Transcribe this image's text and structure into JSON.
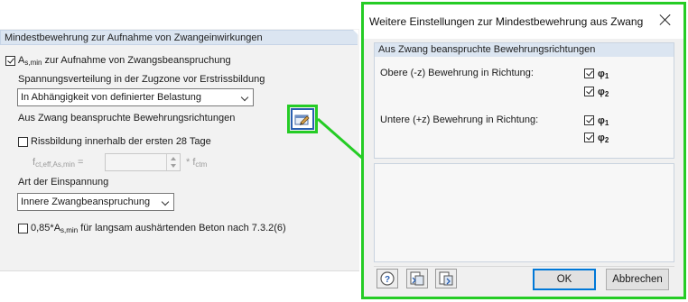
{
  "left_panel": {
    "section_title": "Mindestbewehrung zur Aufnahme von Zwangeinwirkungen",
    "as_min_checkbox": {
      "checked": true,
      "label_prefix": "A",
      "label_sub": "s,min",
      "label_rest": " zur Aufnahme von Zwangsbeanspruchung"
    },
    "stress_label": "Spannungsverteilung in der Zugzone vor Erstrissbildung",
    "stress_dropdown_value": "In Abhängigkeit von definierter Belastung",
    "directions_label": "Aus Zwang beanspruchte Bewehrungsrichtungen",
    "settings_button_icon": "settings-edit-icon",
    "crack_checkbox": {
      "checked": false,
      "label": "Rissbildung innerhalb der ersten 28 Tage"
    },
    "fct_label": {
      "main": "f",
      "sub": "ct,eff,As,min",
      "suffix": " ="
    },
    "fct_value": "",
    "fct_unit": {
      "prefix": "* f",
      "sub": "ctm"
    },
    "restraint_label": "Art der Einspannung",
    "restraint_dropdown_value": "Innere Zwangbeanspruchung",
    "slow_checkbox": {
      "checked": false,
      "label_prefix": "0,85*A",
      "label_sub": "s,min",
      "label_rest": " für langsam aushärtenden Beton nach 7.3.2(6)"
    }
  },
  "dialog": {
    "title": "Weitere Einstellungen zur Mindestbewehrung aus Zwang",
    "group_title": "Aus Zwang beanspruchte Bewehrungsrichtungen",
    "top_label": "Obere (-z) Bewehrung in Richtung:",
    "top_options": [
      {
        "label": "φ",
        "sub": "1",
        "checked": true
      },
      {
        "label": "φ",
        "sub": "2",
        "checked": true
      }
    ],
    "bottom_label": "Untere (+z) Bewehrung in Richtung:",
    "bottom_options": [
      {
        "label": "φ",
        "sub": "1",
        "checked": true
      },
      {
        "label": "φ",
        "sub": "2",
        "checked": true
      }
    ],
    "ok_label": "OK",
    "cancel_label": "Abbrechen",
    "footer_icons": [
      "help-icon",
      "load-defaults-icon",
      "save-defaults-icon"
    ]
  },
  "colors": {
    "highlight": "#25cc25",
    "section_header": "#dbe5f1",
    "accent": "#0078d7"
  }
}
